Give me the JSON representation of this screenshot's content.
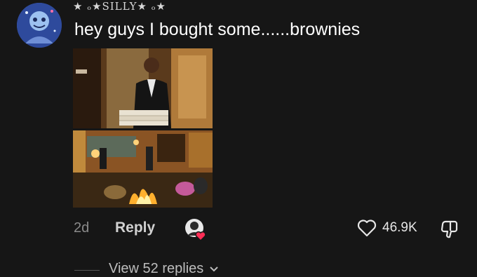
{
  "comment": {
    "username": "★ ₒ★SILLY★ ₒ★",
    "text": "hey guys I bought some......brownies",
    "date": "2d",
    "reply_label": "Reply",
    "like_count": "46.9K",
    "view_replies_label": "View 52 replies"
  },
  "colors": {
    "background": "#161616",
    "creator_heart": "#ff2d55"
  },
  "icons": [
    "avatar",
    "creator-liked-badge",
    "heart-icon",
    "dislike-icon",
    "chevron-down-icon"
  ]
}
